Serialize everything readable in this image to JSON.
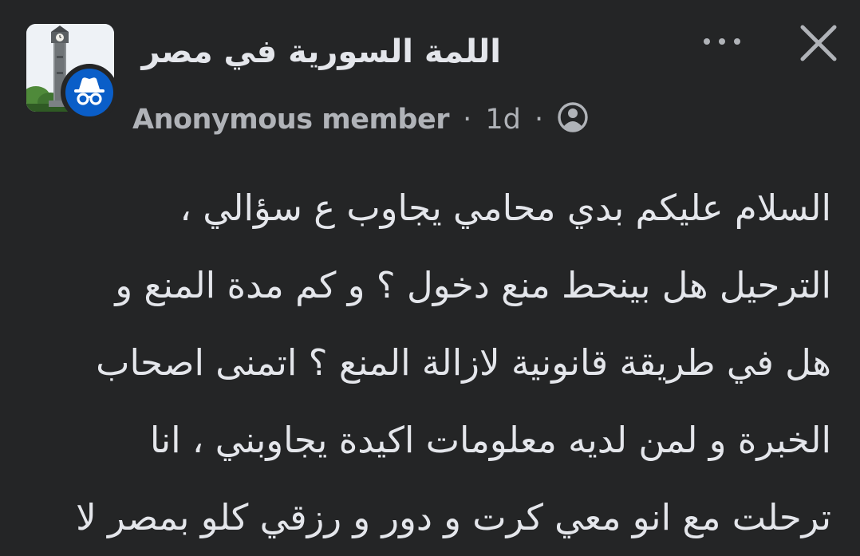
{
  "post": {
    "group_name": "اللمة السورية في مصر",
    "author": "Anonymous member",
    "separator": "·",
    "time": "1d",
    "audience_icon": "public-icon",
    "more_icon": "more-options-icon",
    "close_icon": "close-icon",
    "body_lines": [
      "السلام عليكم بدي محامي يجاوب ع سؤالي ،",
      "الترحيل هل بينحط منع دخول ؟ و كم مدة المنع و",
      "هل في طريقة قانونية لازالة المنع ؟ اتمنى اصحاب",
      "الخبرة و لمن لديه معلومات اكيدة يجاوبني ، انا",
      "ترحلت مع انو معي كرت و دور و رزقي كلو بمصر لا"
    ]
  },
  "colors": {
    "background": "#242526",
    "primary_text": "#e4e6eb",
    "secondary_text": "#b0b3b8",
    "anonymous_badge": "#0a5ec8"
  }
}
